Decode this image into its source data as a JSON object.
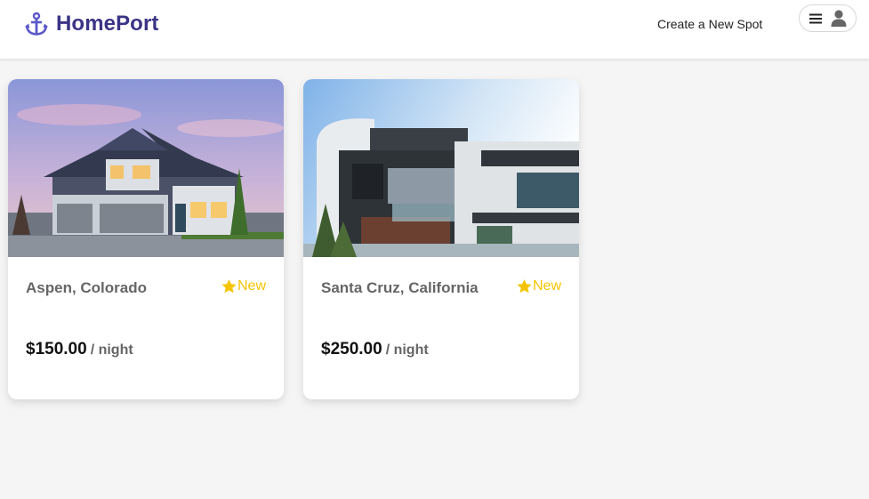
{
  "header": {
    "brand": "HomePort",
    "create_link": "Create a New Spot",
    "brand_color": "#3b3486",
    "anchor_icon_color": "#5b58c9"
  },
  "spots": [
    {
      "title": "Aspen, Colorado",
      "rating": "New",
      "price": "$150.00",
      "unit": "/ night",
      "image": "house-exterior-dusk"
    },
    {
      "title": "Santa Cruz, California",
      "rating": "New",
      "price": "$250.00",
      "unit": "/ night",
      "image": "modern-house-exterior"
    }
  ],
  "icons": {
    "logo": "anchor-icon",
    "menu": "menu-icon",
    "profile": "user-icon",
    "rating": "star-icon"
  },
  "colors": {
    "star": "#f5c400",
    "background": "#f5f5f5"
  }
}
